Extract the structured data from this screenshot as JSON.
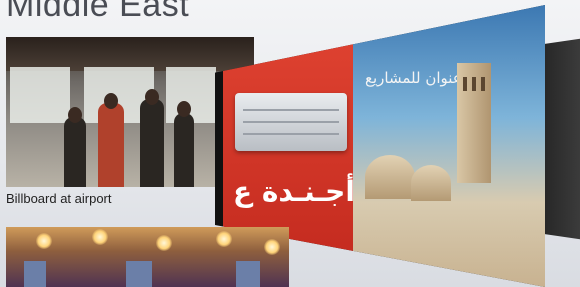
{
  "page": {
    "title": "Middle East"
  },
  "photos": {
    "airport_caption": "Billboard at airport"
  },
  "billboard": {
    "arabic_red_text": "أجـنـدة ع",
    "arabic_sky_text": "عنوان للمشاريع"
  }
}
